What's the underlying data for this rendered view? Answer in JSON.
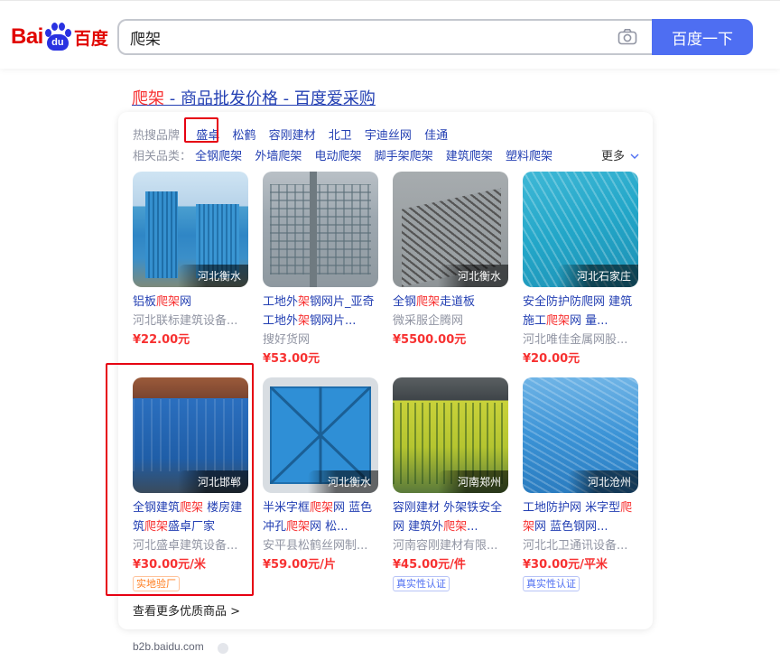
{
  "logo": {
    "bai": "Bai",
    "du": "du",
    "cn": "百度"
  },
  "search": {
    "query": "爬架",
    "button": "百度一下"
  },
  "result": {
    "title_hl": "爬架",
    "title_rest": " - 商品批发价格 - 百度爱采购"
  },
  "hot_brands": {
    "label": "热搜品牌",
    "items": [
      "盛卓",
      "松鹤",
      "容刚建材",
      "北卫",
      "宇迪丝网",
      "佳通"
    ]
  },
  "related": {
    "label": "相关品类：",
    "items": [
      "全钢爬架",
      "外墙爬架",
      "电动爬架",
      "脚手架爬架",
      "建筑爬架",
      "塑料爬架"
    ],
    "more": "更多"
  },
  "products": [
    {
      "loc": "河北衡水",
      "title": [
        "铝板",
        "爬架",
        "网"
      ],
      "shop": "河北联标建筑设备...",
      "price": "¥22.00元"
    },
    {
      "loc": "",
      "title": [
        "工地外",
        "架",
        "钢网片_亚奇工地外",
        "架",
        "钢网片..."
      ],
      "shop": "搜好货网",
      "price": "¥53.00元"
    },
    {
      "loc": "河北衡水",
      "title": [
        "全钢",
        "爬架",
        "走道板"
      ],
      "shop": "微采服企腾网",
      "price": "¥5500.00元"
    },
    {
      "loc": "河北石家庄",
      "title": [
        "安全防护防爬网 建筑施工",
        "爬架",
        "网 量..."
      ],
      "shop": "河北唯佳金属网股...",
      "price": "¥20.00元"
    },
    {
      "loc": "河北邯郸",
      "title": [
        "全钢建筑",
        "爬架",
        " 楼房建筑",
        "爬架",
        "盛卓厂家"
      ],
      "shop": "河北盛卓建筑设备...",
      "price": "¥30.00元/米",
      "badge": "实地验厂"
    },
    {
      "loc": "河北衡水",
      "title": [
        "半米字框",
        "爬架",
        "网 蓝色冲孔",
        "爬架",
        "网 松..."
      ],
      "shop": "安平县松鹤丝网制...",
      "price": "¥59.00元/片"
    },
    {
      "loc": "河南郑州",
      "title": [
        "容刚建材 外架铁安全网 建筑外",
        "爬架",
        "..."
      ],
      "shop": "河南容刚建材有限...",
      "price": "¥45.00元/件",
      "badge": "真实性认证"
    },
    {
      "loc": "河北沧州",
      "title": [
        "工地防护网 米字型",
        "爬",
        "",
        "架",
        "网 蓝色钢网..."
      ],
      "shop": "河北北卫通讯设备...",
      "price": "¥30.00元/平米",
      "badge": "真实性认证"
    }
  ],
  "see_more": "查看更多优质商品 >",
  "source": "b2b.baidu.com",
  "colors": {
    "link": "#2440b3",
    "highlight": "#f73131",
    "button": "#4e6ef2",
    "annotation_box": "#e60012"
  }
}
